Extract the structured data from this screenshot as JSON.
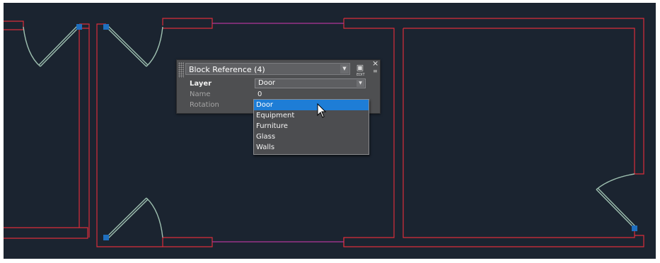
{
  "palette": {
    "selection": "Block Reference (4)",
    "quick_select_label": "EDIT",
    "close_glyph": "×",
    "menu_glyph": "≡",
    "properties": [
      {
        "name": "Layer",
        "value": "Door"
      },
      {
        "name": "Name",
        "value": "0"
      },
      {
        "name": "Rotation",
        "value": ""
      }
    ]
  },
  "layer_dropdown": {
    "options": [
      "Door",
      "Equipment",
      "Furniture",
      "Glass",
      "Walls"
    ],
    "highlighted": "Door"
  },
  "colors": {
    "background": "#1b2430",
    "walls": "#d92d3b",
    "door": "#9ec0b0",
    "door_hinge": "#1f6fbf",
    "glass": "#b0369a",
    "highlight": "#1e7dd6"
  }
}
